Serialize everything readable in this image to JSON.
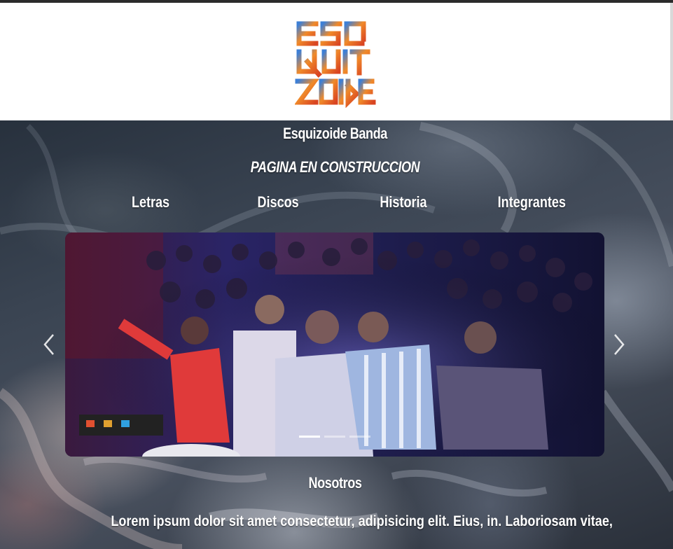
{
  "header": {
    "logo_icon": "esquizoide-logo-icon"
  },
  "site_name": "Esquizoide Banda",
  "notice": "PAGINA EN CONSTRUCCION",
  "nav": {
    "items": [
      {
        "label": "Letras"
      },
      {
        "label": "Discos"
      },
      {
        "label": "Historia"
      },
      {
        "label": "Integrantes"
      }
    ]
  },
  "carousel": {
    "prev_icon": "chevron-left-icon",
    "next_icon": "chevron-right-icon",
    "slide_count": 3,
    "active_slide": 1
  },
  "about": {
    "title": "Nosotros",
    "text": "Lorem ipsum dolor sit amet consectetur, adipisicing elit. Eius, in. Laboriosam vitae,"
  },
  "colors": {
    "header_bg": "#ffffff",
    "text": "#ffffff",
    "carousel_tint": "#2a2070"
  }
}
